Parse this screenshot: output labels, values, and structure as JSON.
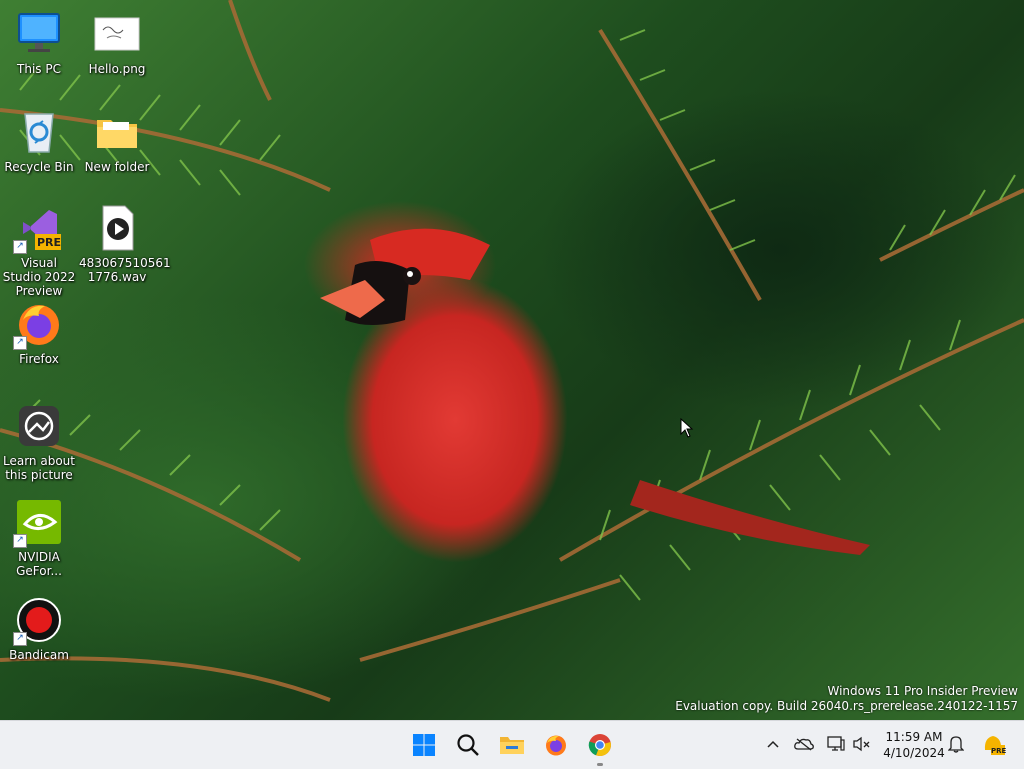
{
  "desktop": {
    "icons": [
      {
        "label": "This PC"
      },
      {
        "label": "Hello.png"
      },
      {
        "label": "Recycle Bin"
      },
      {
        "label": "New folder"
      },
      {
        "label": "Visual Studio 2022 Preview",
        "badge": "PRE"
      },
      {
        "label": "483067510561 1776.wav"
      },
      {
        "label": "Firefox"
      },
      {
        "label": "Learn about this picture"
      },
      {
        "label": "NVIDIA GeFor..."
      },
      {
        "label": "Bandicam"
      }
    ],
    "watermark": {
      "line1": "Windows 11 Pro Insider Preview",
      "line2": "Evaluation copy. Build 26040.rs_prerelease.240122-1157"
    }
  },
  "taskbar": {
    "pinned": [
      "windows-start-icon",
      "search-icon",
      "file-explorer-icon",
      "firefox-icon",
      "chrome-icon"
    ],
    "tray": {
      "time": "11:59 AM",
      "date": "4/10/2024",
      "icons": [
        "chevron-up-icon",
        "onedrive-icon",
        "display-icon",
        "speaker-icon",
        "bell-icon",
        "copilot-icon"
      ],
      "copilot_badge": "PRE"
    }
  },
  "colors": {
    "taskbar_bg": "#eef0f3",
    "accent": "#0078d4"
  }
}
